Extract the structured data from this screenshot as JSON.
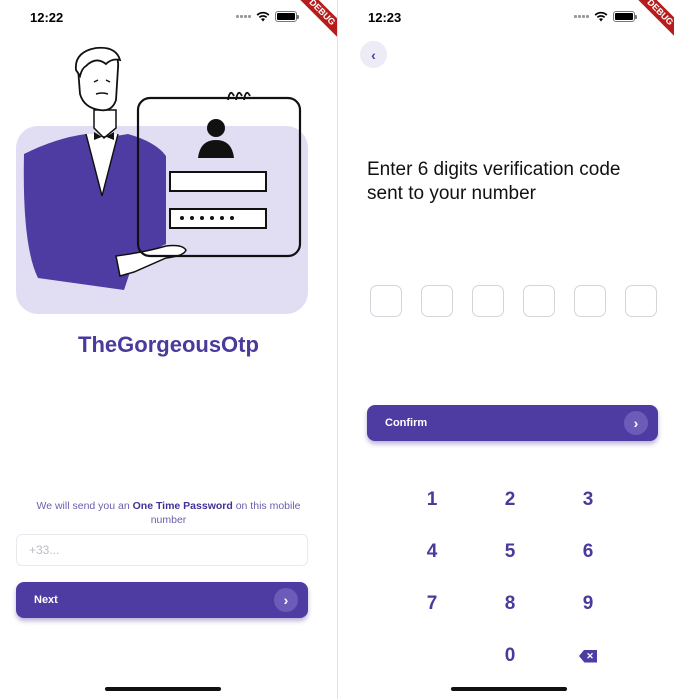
{
  "colors": {
    "primary": "#4e3ca3",
    "title": "#4a3a9c",
    "hero_bg": "#e1def4"
  },
  "screen1": {
    "status_time": "12:22",
    "debug_label": "DEBUG",
    "app_title": "TheGorgeousOtp",
    "info_prefix": "We will send you an ",
    "info_bold": "One Time Password",
    "info_suffix": " on this mobile number",
    "phone_placeholder": "+33...",
    "phone_value": "",
    "next_label": "Next",
    "next_icon": "chevron-right-icon"
  },
  "screen2": {
    "status_time": "12:23",
    "debug_label": "DEBUG",
    "back_icon": "chevron-left-icon",
    "heading": "Enter 6 digits verification code sent to your number",
    "otp_digits": [
      "",
      "",
      "",
      "",
      "",
      ""
    ],
    "confirm_label": "Confirm",
    "confirm_icon": "chevron-right-icon",
    "keypad": [
      "1",
      "2",
      "3",
      "4",
      "5",
      "6",
      "7",
      "8",
      "9",
      "",
      "0",
      "backspace-icon"
    ]
  }
}
